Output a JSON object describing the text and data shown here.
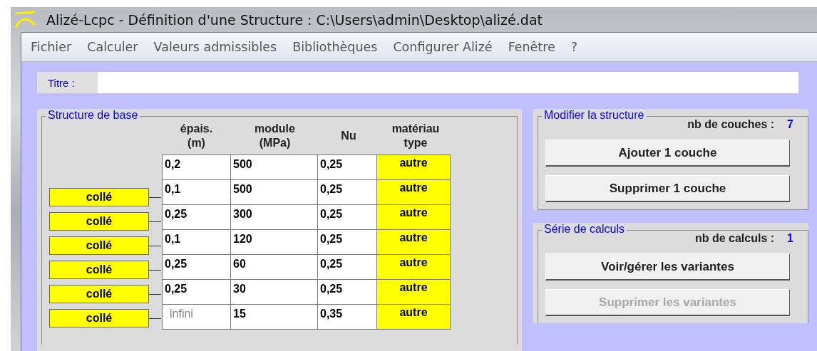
{
  "window": {
    "title": "Alizé-Lcpc - Définition d'une Structure : C:\\Users\\admin\\Desktop\\alizé.dat"
  },
  "menu": [
    "Fichier",
    "Calculer",
    "Valeurs admissibles",
    "Bibliothèques",
    "Configurer Alizé",
    "Fenêtre",
    "?"
  ],
  "title_field": {
    "label": "Titre :"
  },
  "base_structure": {
    "legend": "Structure de base",
    "columns": [
      "épais.\n(m)",
      "module\n(MPa)",
      "Nu",
      "matériau\ntype"
    ],
    "interfaces": [
      "collé",
      "collé",
      "collé",
      "collé",
      "collé",
      "collé"
    ],
    "layers": [
      {
        "thickness": "0,2",
        "modulus": "500",
        "nu": "0,25",
        "material": "autre",
        "thickness_disabled": false
      },
      {
        "thickness": "0,1",
        "modulus": "500",
        "nu": "0,25",
        "material": "autre",
        "thickness_disabled": false
      },
      {
        "thickness": "0,25",
        "modulus": "300",
        "nu": "0,25",
        "material": "autre",
        "thickness_disabled": false
      },
      {
        "thickness": "0,1",
        "modulus": "120",
        "nu": "0,25",
        "material": "autre",
        "thickness_disabled": false
      },
      {
        "thickness": "0,25",
        "modulus": "60",
        "nu": "0,25",
        "material": "autre",
        "thickness_disabled": false
      },
      {
        "thickness": "0,25",
        "modulus": "30",
        "nu": "0,25",
        "material": "autre",
        "thickness_disabled": false
      },
      {
        "thickness": "infini",
        "modulus": "15",
        "nu": "0,35",
        "material": "autre",
        "thickness_disabled": true
      }
    ]
  },
  "panels": [
    {
      "legend": "Modifier la structure",
      "count_label": "nb de couches :",
      "count": "7",
      "buttons": [
        {
          "label": "Ajouter 1 couche",
          "disabled": false
        },
        {
          "label": "Supprimer 1 couche",
          "disabled": false
        }
      ]
    },
    {
      "legend": "Série de calculs",
      "count_label": "nb de calculs :",
      "count": "1",
      "buttons": [
        {
          "label": "Voir/gérer les variantes",
          "disabled": false
        },
        {
          "label": "Supprimer les variantes",
          "disabled": true
        }
      ]
    }
  ]
}
